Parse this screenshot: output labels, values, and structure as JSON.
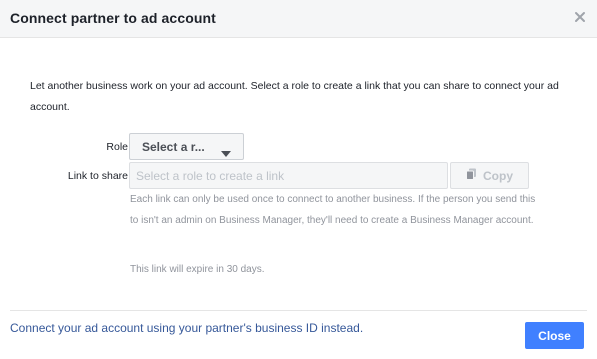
{
  "dialog": {
    "title": "Connect partner to ad account",
    "intro_text": "Let another business work on your ad account. Select a role to create a link that you can share to connect your ad account."
  },
  "form": {
    "role_label": "Role",
    "role_value": "Select a r...",
    "link_label": "Link to share",
    "link_placeholder": "Select a role to create a link",
    "link_value": "",
    "copy_label": "Copy",
    "help_text": "Each link can only be used once to connect to another business. If the person you send this to isn't an admin on Business Manager, they'll need to create a Business Manager account.",
    "expire_text": "This link will expire in 30 days."
  },
  "footer": {
    "link_text": "Connect your ad account using your partner's business ID instead.",
    "close_label": "Close"
  },
  "colors": {
    "primary_button": "#4080ff",
    "link": "#365899",
    "muted_text": "#90949c",
    "header_bg": "#f5f6f7"
  },
  "icons": {
    "close": "close-icon",
    "caret": "caret-down-icon",
    "copy": "copy-icon"
  }
}
